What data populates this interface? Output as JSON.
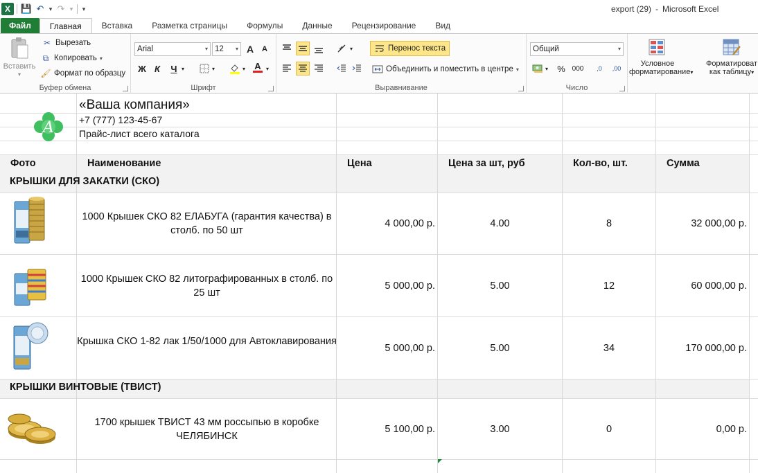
{
  "window": {
    "doc_title": "export (29)",
    "separator": "-",
    "app_title": "Microsoft Excel"
  },
  "qat": {
    "logo": "X",
    "save": "💾",
    "undo": "↶",
    "redo": "↷",
    "more": "▾"
  },
  "tabs": [
    "Файл",
    "Главная",
    "Вставка",
    "Разметка страницы",
    "Формулы",
    "Данные",
    "Рецензирование",
    "Вид"
  ],
  "ribbon": {
    "clipboard": {
      "paste": "Вставить",
      "cut": "Вырезать",
      "copy": "Копировать",
      "format_painter": "Формат по образцу",
      "label": "Буфер обмена"
    },
    "font": {
      "family": "Arial",
      "size": "12",
      "grow": "A",
      "shrink": "A",
      "bold": "Ж",
      "italic": "К",
      "underline": "Ч",
      "font_color_glyph": "A",
      "label": "Шрифт"
    },
    "alignment": {
      "wrap_text": "Перенос текста",
      "merge_center": "Объединить и поместить в центре",
      "label": "Выравнивание"
    },
    "number": {
      "format": "Общий",
      "percent": "%",
      "thousands": "000",
      "inc_decimal": ",0",
      "dec_decimal": ",00",
      "label": "Число"
    },
    "styles": {
      "conditional": [
        "Условное",
        "форматирование"
      ],
      "as_table": [
        "Форматироват",
        "как таблицу"
      ]
    }
  },
  "sheet": {
    "company_name": "«Ваша компания»",
    "phone": "+7 (777) 123-45-67",
    "subtitle": "Прайс-лист всего каталога",
    "headers": {
      "photo": "Фото",
      "name": "Наименование",
      "price": "Цена",
      "unit_price": "Цена за шт, руб",
      "qty": "Кол-во, шт.",
      "sum": "Сумма"
    },
    "categories": [
      "КРЫШКИ ДЛЯ ЗАКАТКИ (СКО)",
      "КРЫШКИ ВИНТОВЫЕ (ТВИСТ)"
    ],
    "rows": [
      {
        "name": "1000 Крышек СКО 82 ЕЛАБУГА (гарантия качества) в столб. по 50 шт",
        "price": "4 000,00 р.",
        "unit_price": "4.00",
        "qty": "8",
        "sum": "32 000,00 р."
      },
      {
        "name": "1000 Крышек СКО 82 литографированных в столб. по 25 шт",
        "price": "5 000,00 р.",
        "unit_price": "5.00",
        "qty": "12",
        "sum": "60 000,00 р."
      },
      {
        "name": "Крышка СКО 1-82 лак 1/50/1000 для Автоклавирования",
        "price": "5 000,00 р.",
        "unit_price": "5.00",
        "qty": "34",
        "sum": "170 000,00 р."
      },
      {
        "name": "1700 крышек ТВИСТ 43 мм россыпью в коробке ЧЕЛЯБИНСК",
        "price": "5 100,00 р.",
        "unit_price": "3.00",
        "qty": "0",
        "sum": "0,00 р."
      }
    ],
    "logo_letter": "A",
    "colors": {
      "accent": "#1f7d35",
      "logo": "#3fbf5f",
      "selected": "#fde589",
      "band": "#f2f2f2"
    }
  }
}
